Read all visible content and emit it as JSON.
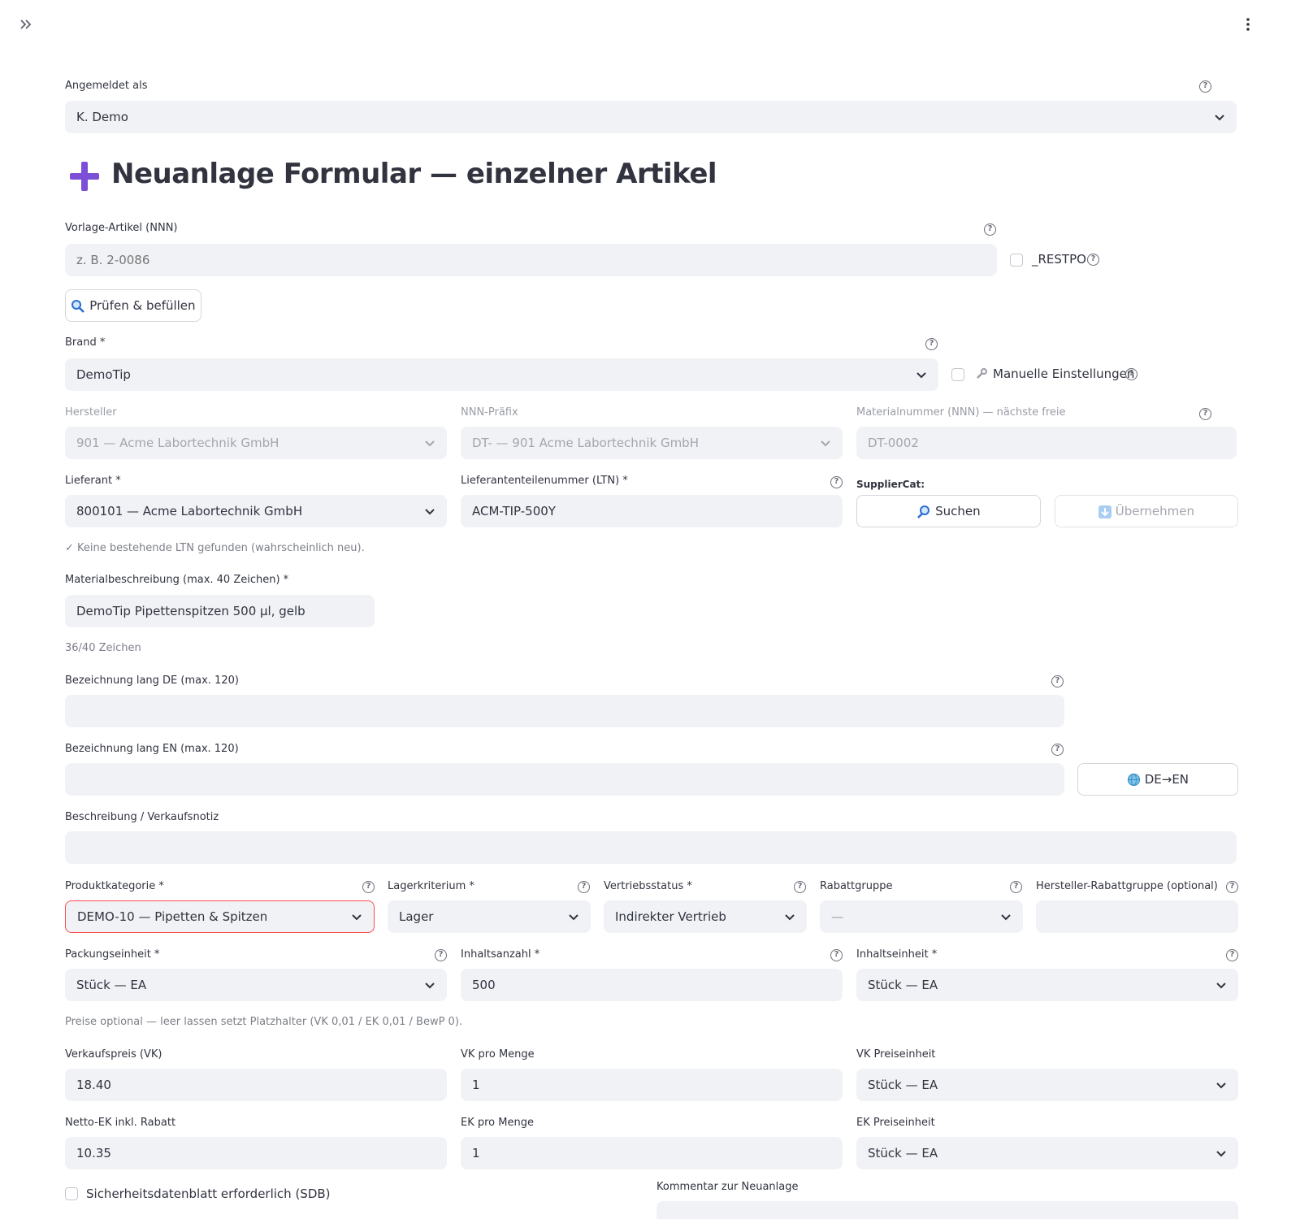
{
  "login": {
    "label": "Angemeldet als",
    "value": "K. Demo"
  },
  "title": {
    "text": "Neuanlage Formular — einzelner Artikel",
    "accent": "#7b4fd6"
  },
  "vorlage": {
    "label": "Vorlage-Artikel (NNN)",
    "placeholder": "z. B. 2-0086",
    "restpo_label": "_RESTPO"
  },
  "check_button": {
    "label": "Prüfen & befüllen"
  },
  "brand": {
    "label": "Brand *",
    "value": "DemoTip",
    "manual_label": "Manuelle Einstellungen"
  },
  "hersteller": {
    "label": "Hersteller",
    "value": "901 — Acme Labortechnik GmbH"
  },
  "nnn_prefix": {
    "label": "NNN-Präfix",
    "value": "DT- — 901 Acme Labortechnik GmbH"
  },
  "materialnummer": {
    "label": "Materialnummer (NNN) — nächste freie",
    "value": "DT-0002"
  },
  "lieferant": {
    "label": "Lieferant *",
    "value": "800101 — Acme Labortechnik GmbH"
  },
  "ltn": {
    "label": "Lieferantenteilenummer (LTN) *",
    "value": "ACM-TIP-500Y",
    "hint": "✓ Keine bestehende LTN gefunden (wahrscheinlich neu)."
  },
  "suppliercat": {
    "label": "SupplierCat:",
    "search_label": "Suchen",
    "apply_label": "Übernehmen"
  },
  "materialbeschreibung": {
    "label": "Materialbeschreibung (max. 40 Zeichen) *",
    "value": "DemoTip Pipettenspitzen 500 µl, gelb",
    "counter": "36/40 Zeichen"
  },
  "bez_de": {
    "label": "Bezeichnung lang DE (max. 120)",
    "value": ""
  },
  "bez_en": {
    "label": "Bezeichnung lang EN (max. 120)",
    "value": "",
    "translate_label": "DE→EN"
  },
  "beschreibung": {
    "label": "Beschreibung / Verkaufsnotiz",
    "value": ""
  },
  "produktkategorie": {
    "label": "Produktkategorie *",
    "value": "DEMO-10 — Pipetten & Spitzen"
  },
  "lagerkriterium": {
    "label": "Lagerkriterium *",
    "value": "Lager"
  },
  "vertriebsstatus": {
    "label": "Vertriebsstatus *",
    "value": "Indirekter Vertrieb"
  },
  "rabattgruppe": {
    "label": "Rabattgruppe",
    "value": "—"
  },
  "hersteller_rabattgruppe": {
    "label": "Hersteller-Rabattgruppe (optional)",
    "value": ""
  },
  "packungseinheit": {
    "label": "Packungseinheit *",
    "value": "Stück — EA"
  },
  "inhaltsanzahl": {
    "label": "Inhaltsanzahl *",
    "value": "500"
  },
  "inhaltseinheit": {
    "label": "Inhaltseinheit *",
    "value": "Stück — EA"
  },
  "price_note": "Preise optional — leer lassen setzt Platzhalter (VK 0,01 / EK 0,01 / BewP 0).",
  "vk": {
    "label": "Verkaufspreis (VK)",
    "value": "18.40"
  },
  "vk_menge": {
    "label": "VK pro Menge",
    "value": "1"
  },
  "vk_einheit": {
    "label": "VK Preiseinheit",
    "value": "Stück — EA"
  },
  "ek": {
    "label": "Netto-EK inkl. Rabatt",
    "value": "10.35"
  },
  "ek_menge": {
    "label": "EK pro Menge",
    "value": "1"
  },
  "ek_einheit": {
    "label": "EK Preiseinheit",
    "value": "Stück — EA"
  },
  "sdb": {
    "label": "Sicherheitsdatenblatt erforderlich (SDB)"
  },
  "kommentar": {
    "label": "Kommentar zur Neuanlage",
    "value": ""
  }
}
